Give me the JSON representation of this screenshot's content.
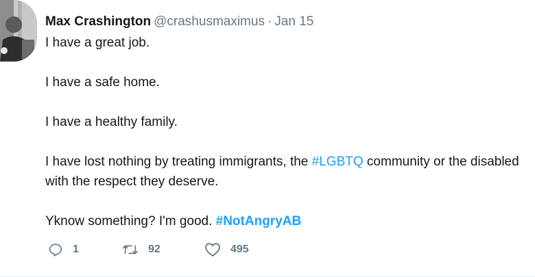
{
  "author": {
    "name": "Max Crashington",
    "handle": "@crashusmaximus",
    "separator": "·",
    "date": "Jan 15"
  },
  "tweet": {
    "line1": "I have a great job.",
    "line2": "I have a safe home.",
    "line3": "I have a healthy family.",
    "line4_before": "I have lost nothing by treating immigrants, the ",
    "line4_hashtag": "#LGBTQ",
    "line4_after": " community or the disabled with the respect they deserve.",
    "line5_before": "Yknow something? I'm good. ",
    "line5_hashtag": "#NotAngryAB"
  },
  "actions": {
    "reply": {
      "icon": "reply-icon",
      "count": "1"
    },
    "retweet": {
      "icon": "retweet-icon",
      "count": "92"
    },
    "like": {
      "icon": "heart-icon",
      "count": "495"
    }
  },
  "colors": {
    "text": "#14171a",
    "secondary": "#657786",
    "link": "#1da1f2"
  }
}
